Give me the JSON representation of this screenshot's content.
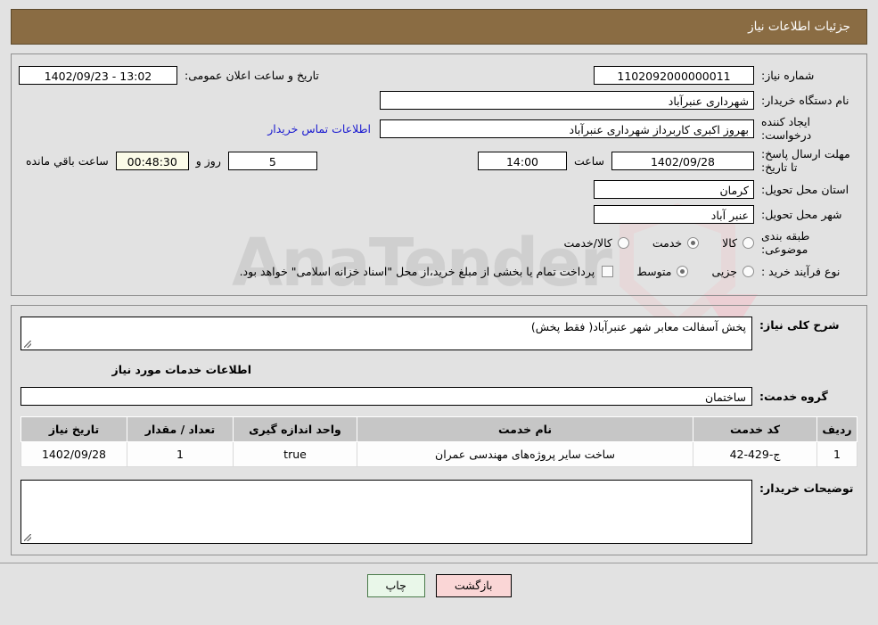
{
  "header": {
    "title": "جزئیات اطلاعات نیاز"
  },
  "form": {
    "need_number_label": "شماره نیاز:",
    "need_number_value": "1102092000000011",
    "public_announce_label": "تاریخ و ساعت اعلان عمومی:",
    "public_announce_value": "1402/09/23 - 13:02",
    "buyer_org_label": "نام دستگاه خریدار:",
    "buyer_org_value": "شهرداری عنبرآباد",
    "creator_label": "ایجاد کننده درخواست:",
    "creator_value": "بهروز اکبری کاربرداز شهرداری عنبرآباد",
    "contact_link": "اطلاعات تماس خریدار",
    "deadline_label": "مهلت ارسال پاسخ: تا تاریخ:",
    "deadline_date": "1402/09/28",
    "hour_label": "ساعت",
    "deadline_time": "14:00",
    "days_remaining": "5",
    "days_label": "روز و",
    "countdown": "00:48:30",
    "countdown_label": "ساعت باقي مانده",
    "province_label": "استان محل تحویل:",
    "province_value": "کرمان",
    "city_label": "شهر محل تحویل:",
    "city_value": "عنبر آباد",
    "category_label": "طبقه بندی موضوعی:",
    "category_options": [
      {
        "label": "کالا",
        "selected": false
      },
      {
        "label": "خدمت",
        "selected": true
      },
      {
        "label": "کالا/خدمت",
        "selected": false
      }
    ],
    "process_label": "نوع فرآیند خرید :",
    "process_options": [
      {
        "label": "جزیی",
        "selected": false
      },
      {
        "label": "متوسط",
        "selected": true
      }
    ],
    "treasury_checked": false,
    "treasury_note": "پرداخت تمام یا بخشی از مبلغ خرید،از محل \"اسناد خزانه اسلامی\" خواهد بود."
  },
  "details": {
    "need_desc_label": "شرح کلی نیاز:",
    "need_desc_value": "پخش آسفالت معابر شهر عنبرآباد( فقط پخش)",
    "services_section_title": "اطلاعات خدمات مورد نیاز",
    "service_group_label": "گروه خدمت:",
    "service_group_value": "ساختمان",
    "buyer_notes_label": "توضیحات خریدار:",
    "buyer_notes_value": ""
  },
  "table": {
    "headers": {
      "radif": "ردیف",
      "code": "کد خدمت",
      "name": "نام خدمت",
      "unit": "واحد اندازه گیری",
      "qty": "تعداد / مقدار",
      "date": "تاریخ نیاز"
    },
    "rows": [
      {
        "radif": "1",
        "code": "ج-429-42",
        "name": "ساخت سایر پروژه‌های مهندسی عمران",
        "unit": "true",
        "qty": "1",
        "date": "1402/09/28"
      }
    ]
  },
  "footer": {
    "print_label": "چاپ",
    "back_label": "بازگشت"
  },
  "watermark": {
    "text": "AnaTender"
  },
  "colors": {
    "header_bg": "#8a6c43",
    "page_bg": "#e2e2e2",
    "link": "#1b1bd0",
    "table_header_bg": "#c6c6c6",
    "print_btn_bg": "#e9f7e9",
    "back_btn_bg": "#fad6d6",
    "timer_bg": "#fbfbe8"
  }
}
